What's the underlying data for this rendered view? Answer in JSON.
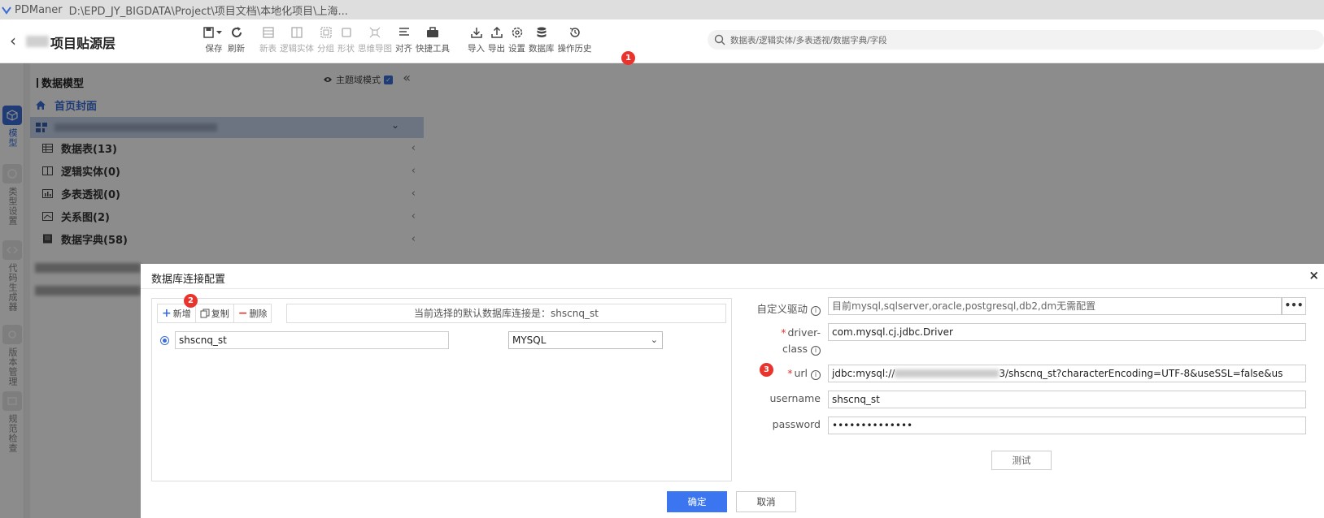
{
  "window": {
    "app_name": "PDManer",
    "path": "D:\\EPD_JY_BIGDATA\\Project\\项目文档\\本地化项目\\上海..."
  },
  "header": {
    "project_title": "项目贴源层"
  },
  "toolbar": {
    "items": [
      {
        "label": "保存",
        "icon": "save-icon"
      },
      {
        "label": "刷新",
        "icon": "refresh-icon"
      },
      {
        "label": "新表",
        "icon": "new-table-icon"
      },
      {
        "label": "逻辑实体",
        "icon": "logic-entity-icon"
      },
      {
        "label": "分组",
        "icon": "group-icon"
      },
      {
        "label": "形状",
        "icon": "shape-icon"
      },
      {
        "label": "思维导图",
        "icon": "mindmap-icon"
      },
      {
        "label": "对齐",
        "icon": "align-icon"
      },
      {
        "label": "快捷工具",
        "icon": "toolbox-icon"
      },
      {
        "label": "导入",
        "icon": "import-icon"
      },
      {
        "label": "导出",
        "icon": "export-icon"
      },
      {
        "label": "设置",
        "icon": "gear-icon"
      },
      {
        "label": "数据库",
        "icon": "database-icon"
      },
      {
        "label": "操作历史",
        "icon": "history-icon"
      }
    ]
  },
  "search": {
    "placeholder": "数据表/逻辑实体/多表透视/数据字典/字段"
  },
  "rail": {
    "items": [
      {
        "label": "模型"
      },
      {
        "label": "类型设置"
      },
      {
        "label": "代码生成器"
      },
      {
        "label": "版本管理"
      },
      {
        "label": "规范检查"
      }
    ]
  },
  "tree": {
    "title": "数据模型",
    "domain_mode_label": "主题域模式",
    "home_label": "首页封面",
    "items": [
      {
        "label": "数据表(13)",
        "icon": "table-icon"
      },
      {
        "label": "逻辑实体(0)",
        "icon": "entity-icon"
      },
      {
        "label": "多表透视(0)",
        "icon": "pivot-icon"
      },
      {
        "label": "关系图(2)",
        "icon": "relation-icon"
      },
      {
        "label": "数据字典(58)",
        "icon": "dictionary-icon"
      }
    ]
  },
  "badges": {
    "b1": "1",
    "b2": "2",
    "b3": "3"
  },
  "modal": {
    "title": "数据库连接配置",
    "close": "×",
    "buttons": {
      "add": "新增",
      "copy": "复制",
      "delete": "删除"
    },
    "default_note": "当前选择的默认数据库连接是：shscnq_st",
    "connection": {
      "name": "shscnq_st",
      "db_type": "MYSQL"
    },
    "form": {
      "custom_driver_label": "自定义驱动",
      "custom_driver_value": "目前mysql,sqlserver,oracle,postgresql,db2,dm无需配置",
      "more": "•••",
      "driver_class_label_1": "driver-",
      "driver_class_label_2": "class",
      "driver_class_value": "com.mysql.cj.jdbc.Driver",
      "url_label": "url",
      "url_prefix": "jdbc:mysql://",
      "url_suffix": "3/shscnq_st?characterEncoding=UTF-8&useSSL=false&us",
      "username_label": "username",
      "username_value": "shscnq_st",
      "password_label": "password",
      "password_value": "••••••••••••••",
      "test": "测试"
    },
    "ok": "确定",
    "cancel": "取消"
  },
  "colors": {
    "accent": "#3b76f0",
    "badge": "#e8342c",
    "selected_row": "#c6d4ec"
  }
}
